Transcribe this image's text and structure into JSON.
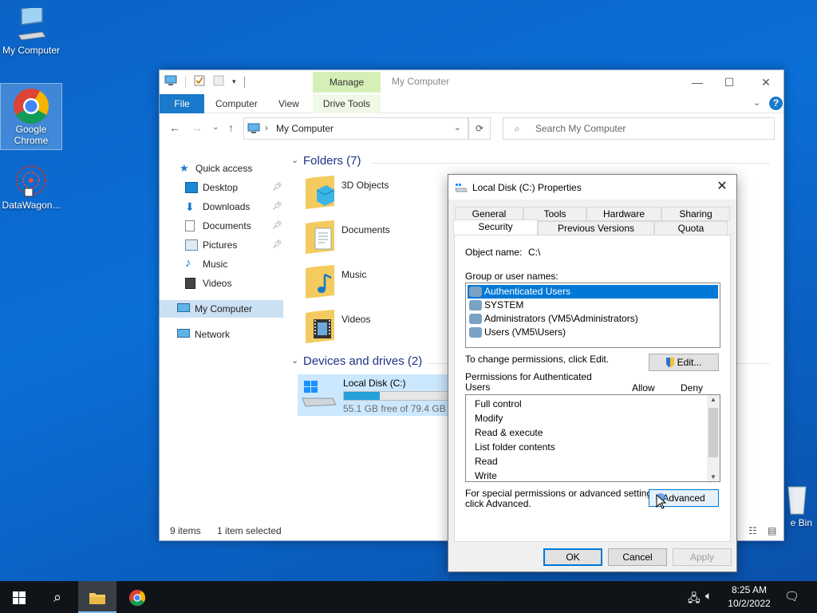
{
  "desktop": {
    "icons": [
      {
        "label": "My Computer"
      },
      {
        "label": "Google Chrome"
      },
      {
        "label": "DataWagon..."
      },
      {
        "label": "e Bin"
      }
    ]
  },
  "explorer": {
    "title": "My Computer",
    "manage_label": "Manage",
    "ribbon_tabs": [
      "File",
      "Computer",
      "View",
      "Drive Tools"
    ],
    "address": "My Computer",
    "search_placeholder": "Search My Computer",
    "nav": {
      "quick_access": "Quick access",
      "items": [
        "Desktop",
        "Downloads",
        "Documents",
        "Pictures",
        "Music",
        "Videos"
      ],
      "my_computer": "My Computer",
      "network": "Network"
    },
    "folders_header": "Folders (7)",
    "folders": [
      "3D Objects",
      "Documents",
      "Music",
      "Videos"
    ],
    "devices_header": "Devices and drives (2)",
    "drive": {
      "name": "Local Disk (C:)",
      "free_text": "55.1 GB free of 79.4 GB",
      "used_fraction": 0.306
    },
    "status": {
      "items": "9 items",
      "selected": "1 item selected"
    }
  },
  "dialog": {
    "title": "Local Disk (C:) Properties",
    "tabs_row1": [
      "General",
      "Tools",
      "Hardware",
      "Sharing"
    ],
    "tabs_row2": [
      "Security",
      "Previous Versions",
      "Quota"
    ],
    "object_name_label": "Object name:",
    "object_name_value": "C:\\",
    "group_label": "Group or user names:",
    "groups": [
      "Authenticated Users",
      "SYSTEM",
      "Administrators (VM5\\Administrators)",
      "Users (VM5\\Users)"
    ],
    "change_text": "To change permissions, click Edit.",
    "edit_button": "Edit...",
    "perms_label_line1": "Permissions for Authenticated",
    "perms_label_line2": "Users",
    "allow_label": "Allow",
    "deny_label": "Deny",
    "permissions": [
      "Full control",
      "Modify",
      "Read & execute",
      "List folder contents",
      "Read",
      "Write"
    ],
    "special_line1": "For special permissions or advanced settings,",
    "special_line2": "click Advanced.",
    "advanced_button": "Advanced",
    "ok": "OK",
    "cancel": "Cancel",
    "apply": "Apply"
  },
  "taskbar": {
    "time": "8:25 AM",
    "date": "10/2/2022"
  }
}
